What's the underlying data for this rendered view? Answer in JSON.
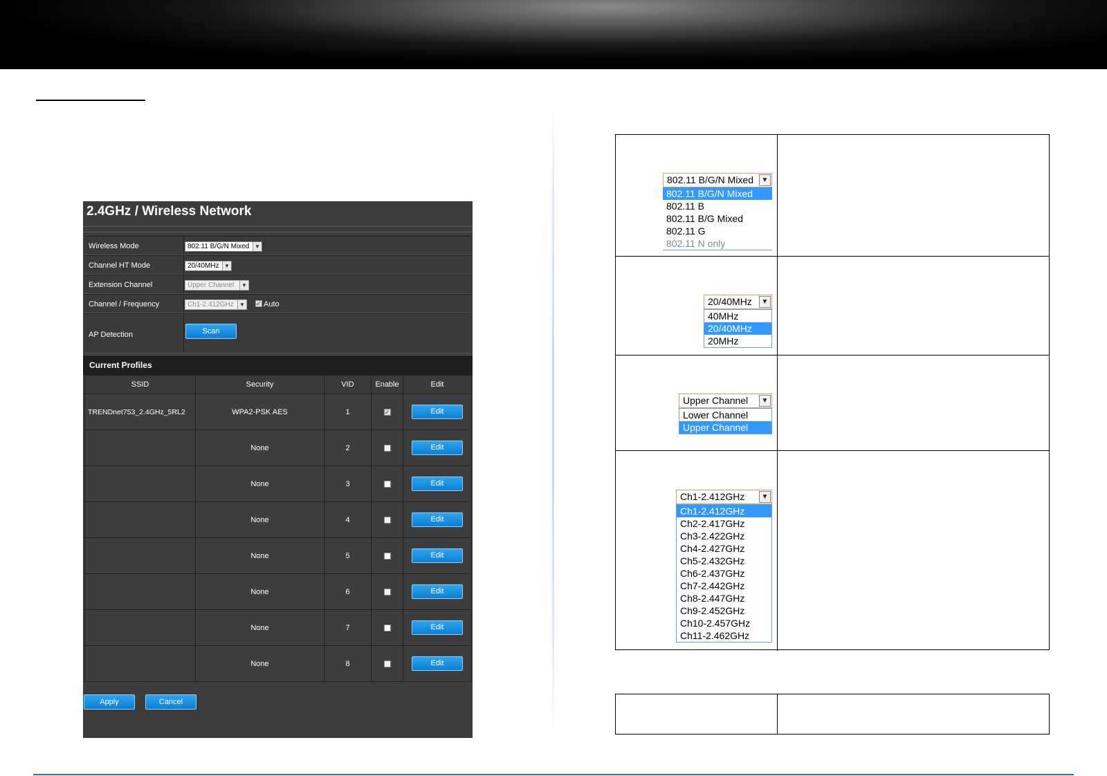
{
  "panel": {
    "title": "2.4GHz / Wireless Network",
    "rows": {
      "wireless_mode": {
        "label": "Wireless Mode",
        "value": "802.11 B/G/N Mixed"
      },
      "channel_ht_mode": {
        "label": "Channel HT Mode",
        "value": "20/40MHz"
      },
      "extension_channel": {
        "label": "Extension Channel",
        "value": "Upper Channel"
      },
      "channel_frequency": {
        "label": "Channel / Frequency",
        "value": "Ch1-2.412GHz",
        "auto_label": "Auto",
        "auto_checked": true
      },
      "ap_detection": {
        "label": "AP Detection",
        "button": "Scan"
      }
    },
    "profiles": {
      "title": "Current Profiles",
      "columns": [
        "SSID",
        "Security",
        "VID",
        "Enable",
        "Edit"
      ],
      "rows": [
        {
          "ssid": "TRENDnet753_2.4GHz_5RL2",
          "security": "WPA2-PSK AES",
          "vid": "1",
          "enabled": true,
          "edit": "Edit"
        },
        {
          "ssid": "",
          "security": "None",
          "vid": "2",
          "enabled": false,
          "edit": "Edit"
        },
        {
          "ssid": "",
          "security": "None",
          "vid": "3",
          "enabled": false,
          "edit": "Edit"
        },
        {
          "ssid": "",
          "security": "None",
          "vid": "4",
          "enabled": false,
          "edit": "Edit"
        },
        {
          "ssid": "",
          "security": "None",
          "vid": "5",
          "enabled": false,
          "edit": "Edit"
        },
        {
          "ssid": "",
          "security": "None",
          "vid": "6",
          "enabled": false,
          "edit": "Edit"
        },
        {
          "ssid": "",
          "security": "None",
          "vid": "7",
          "enabled": false,
          "edit": "Edit"
        },
        {
          "ssid": "",
          "security": "None",
          "vid": "8",
          "enabled": false,
          "edit": "Edit"
        }
      ]
    },
    "apply": "Apply",
    "cancel": "Cancel"
  },
  "dropdowns": {
    "wireless_mode": {
      "selected": "802.11 B/G/N Mixed",
      "options": [
        "802.11 B/G/N Mixed",
        "802.11 B",
        "802.11 B/G Mixed",
        "802.11 G",
        "802.11 N only"
      ],
      "highlighted": 0
    },
    "channel_ht_mode": {
      "selected": "20/40MHz",
      "options": [
        "40MHz",
        "20/40MHz",
        "20MHz"
      ],
      "highlighted": 1
    },
    "extension_channel": {
      "selected": "Upper Channel",
      "options": [
        "Lower Channel",
        "Upper Channel"
      ],
      "highlighted": 1
    },
    "channel_frequency": {
      "selected": "Ch1-2.412GHz",
      "options": [
        "Ch1-2.412GHz",
        "Ch2-2.417GHz",
        "Ch3-2.422GHz",
        "Ch4-2.427GHz",
        "Ch5-2.432GHz",
        "Ch6-2.437GHz",
        "Ch7-2.442GHz",
        "Ch8-2.447GHz",
        "Ch9-2.452GHz",
        "Ch10-2.457GHz",
        "Ch11-2.462GHz"
      ],
      "highlighted": 0
    }
  },
  "icons": {
    "dropdown_arrow": "chevron-down-icon",
    "checkbox": "checkbox-icon"
  },
  "colors": {
    "panel_bg": "#3c3c3c",
    "button_blue": "#0a7fd5",
    "highlight": "#3399ff",
    "footer_line": "#2e6fb7"
  }
}
